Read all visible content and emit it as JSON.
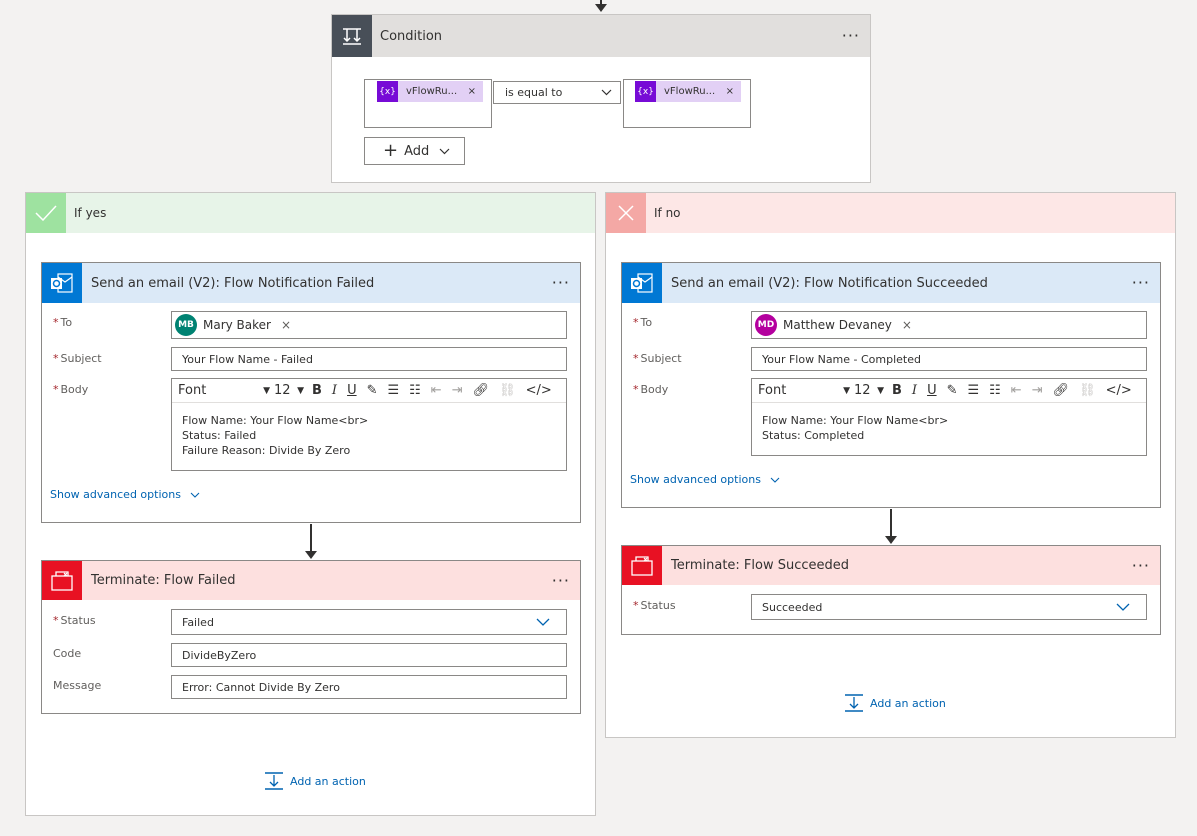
{
  "condition": {
    "title": "Condition",
    "more": "···",
    "left_token": "vFlowRu...",
    "right_token": "vFlowRu...",
    "token_icon": "{x}",
    "token_remove": "×",
    "operator": "is equal to",
    "add_label": "Add"
  },
  "yes_branch": {
    "title": "If yes",
    "color": "#9ee2a0",
    "email": {
      "title": "Send an email (V2): Flow Notification Failed",
      "more": "···",
      "to_label": "To",
      "to_initials": "MB",
      "to_name": "Mary Baker",
      "to_avatar_color": "#008272",
      "chip_remove": "×",
      "subject_label": "Subject",
      "subject_value": "Your Flow Name -  Failed",
      "body_label": "Body",
      "font": "Font",
      "size": "12",
      "body_lines": [
        "Flow Name: Your Flow Name<br>",
        "Status: Failed",
        "Failure Reason: Divide By Zero"
      ],
      "advanced": "Show advanced options"
    },
    "terminate": {
      "title": "Terminate: Flow Failed",
      "more": "···",
      "status_label": "Status",
      "status_value": "Failed",
      "code_label": "Code",
      "code_value": "DivideByZero",
      "message_label": "Message",
      "message_value": "Error: Cannot Divide By Zero"
    },
    "add_action": "Add an action"
  },
  "no_branch": {
    "title": "If no",
    "color": "#f4a8a5",
    "email": {
      "title": "Send an email (V2): Flow Notification Succeeded",
      "more": "···",
      "to_label": "To",
      "to_initials": "MD",
      "to_name": "Matthew Devaney",
      "to_avatar_color": "#b4009e",
      "chip_remove": "×",
      "subject_label": "Subject",
      "subject_value": "Your Flow Name - Completed",
      "body_label": "Body",
      "font": "Font",
      "size": "12",
      "body_lines": [
        "Flow Name: Your Flow Name<br>",
        "Status: Completed"
      ],
      "advanced": "Show advanced options"
    },
    "terminate": {
      "title": "Terminate: Flow Succeeded",
      "more": "···",
      "status_label": "Status",
      "status_value": "Succeeded"
    },
    "add_action": "Add an action"
  },
  "required_marker": "*",
  "colors": {
    "email_header": "#dbe9f7",
    "outlook_icon": "#0078d4",
    "terminate_header": "#fde0df",
    "terminate_icon": "#e81123",
    "condition_header": "#e1dfdd",
    "condition_icon": "#484f58",
    "token": "#770bd6"
  },
  "toolbar_icons": [
    "bold-icon",
    "italic-icon",
    "underline-icon",
    "brush-icon",
    "bullet-list-icon",
    "numbered-list-icon",
    "outdent-icon",
    "indent-icon",
    "link-icon",
    "unlink-icon",
    "code-view-icon"
  ]
}
